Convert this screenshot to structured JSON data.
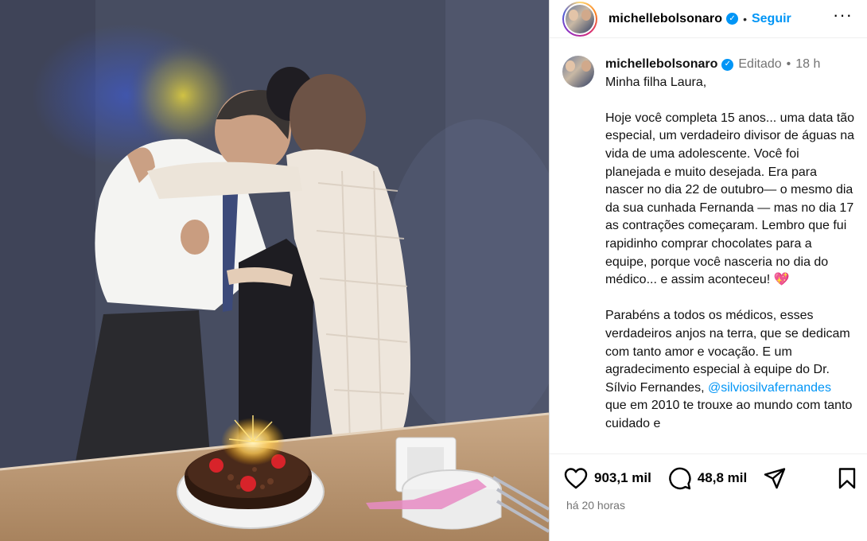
{
  "post": {
    "username": "michellebolsonaro",
    "follow_label": "Seguir",
    "edited_label": "Editado",
    "age": "18 h",
    "caption": {
      "greeting": "Minha filha Laura,",
      "paragraph1": "Hoje você completa 15 anos... uma data tão especial, um verdadeiro divisor de águas na vida de uma adolescente. Você foi planejada e muito desejada. Era para nascer no dia 22 de outubro— o mesmo dia da sua cunhada Fernanda — mas no dia 17 as contrações começaram. Lembro que fui rapidinho comprar chocolates para a equipe, porque você nasceria no dia do médico... e assim aconteceu! 💖",
      "paragraph2": "Parabéns a todos os médicos, esses verdadeiros anjos na terra, que se dedicam com tanto amor e vocação. E um agradecimento especial à equipe do Dr. Sílvio Fernandes,",
      "mention": "@silviosilvafernandes",
      "paragraph2_tail": " que em 2010 te trouxe ao mundo com tanto cuidado e"
    },
    "likes": "903,1 mil",
    "comments": "48,8 mil",
    "timestamp": "há 20 horas"
  },
  "icons": {
    "verified": "verified-badge-icon",
    "more": "more-options-icon",
    "like": "heart-icon",
    "comment": "comment-icon",
    "share": "share-icon",
    "save": "bookmark-icon"
  },
  "colors": {
    "accent": "#0095f6",
    "muted": "#737373"
  }
}
